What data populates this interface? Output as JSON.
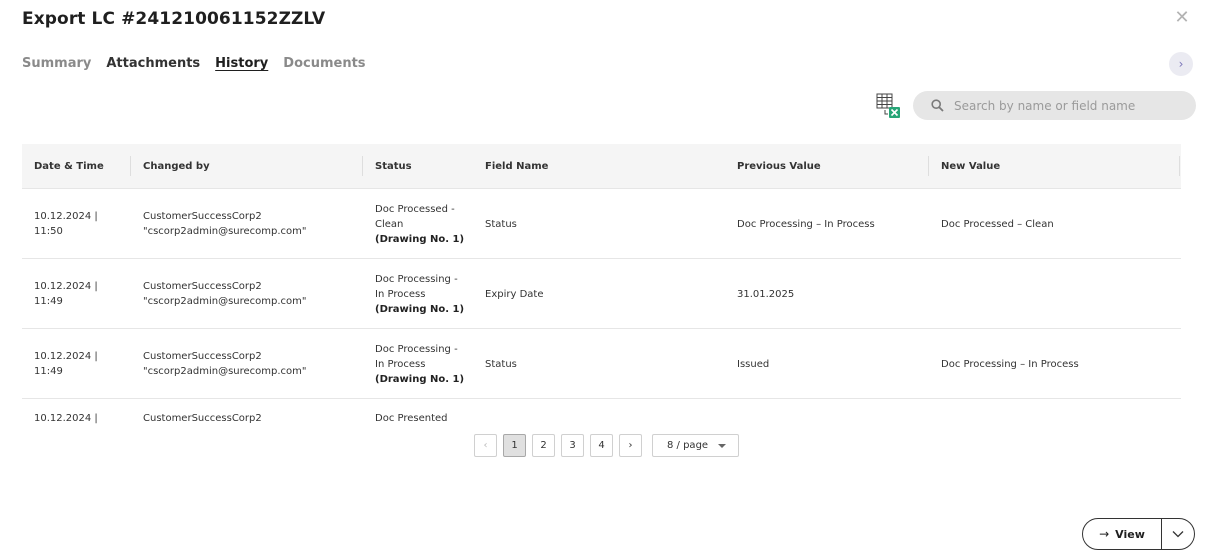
{
  "modal": {
    "title": "Export LC #241210061152ZZLV",
    "close_glyph": "✕"
  },
  "tabs": [
    {
      "label": "Summary",
      "state": "inactive"
    },
    {
      "label": "Attachments",
      "state": "inactive"
    },
    {
      "label": "History",
      "state": "active"
    },
    {
      "label": "Documents",
      "state": "inactive"
    }
  ],
  "toolbar": {
    "next_glyph": "›",
    "export_icon": "excel-export-icon",
    "search_icon": "search-icon",
    "search_placeholder": "Search by name or field name",
    "search_value": ""
  },
  "table": {
    "columns": [
      "Date & Time",
      "Changed by",
      "Status",
      "Field Name",
      "Previous Value",
      "New Value"
    ],
    "rows": [
      {
        "date": "10.12.2024 |",
        "time": "11:50",
        "user": "CustomerSuccessCorp2",
        "email": "\"cscorp2admin@surecomp.com\"",
        "status_l1": "Doc Processed -",
        "status_l2": "Clean",
        "drawing": "(Drawing No. 1)",
        "field": "Status",
        "previous": "Doc Processing – In Process",
        "new": "Doc Processed – Clean"
      },
      {
        "date": "10.12.2024 |",
        "time": "11:49",
        "user": "CustomerSuccessCorp2",
        "email": "\"cscorp2admin@surecomp.com\"",
        "status_l1": "Doc Processing -",
        "status_l2": "In Process",
        "drawing": "(Drawing No. 1)",
        "field": "Expiry Date",
        "previous": "31.01.2025",
        "new": ""
      },
      {
        "date": "10.12.2024 |",
        "time": "11:49",
        "user": "CustomerSuccessCorp2",
        "email": "\"cscorp2admin@surecomp.com\"",
        "status_l1": "Doc Processing -",
        "status_l2": "In Process",
        "drawing": "(Drawing No. 1)",
        "field": "Status",
        "previous": "Issued",
        "new": "Doc Processing – In Process"
      },
      {
        "date": "10.12.2024 |",
        "user": "CustomerSuccessCorp2",
        "status_l1": "Doc Presented"
      }
    ]
  },
  "pagination": {
    "prev_glyph": "‹",
    "next_glyph": "›",
    "pages": [
      "1",
      "2",
      "3",
      "4"
    ],
    "current_page": "1",
    "page_size": "8 / page"
  },
  "footer": {
    "view_label": "View",
    "view_arrow": "→"
  }
}
